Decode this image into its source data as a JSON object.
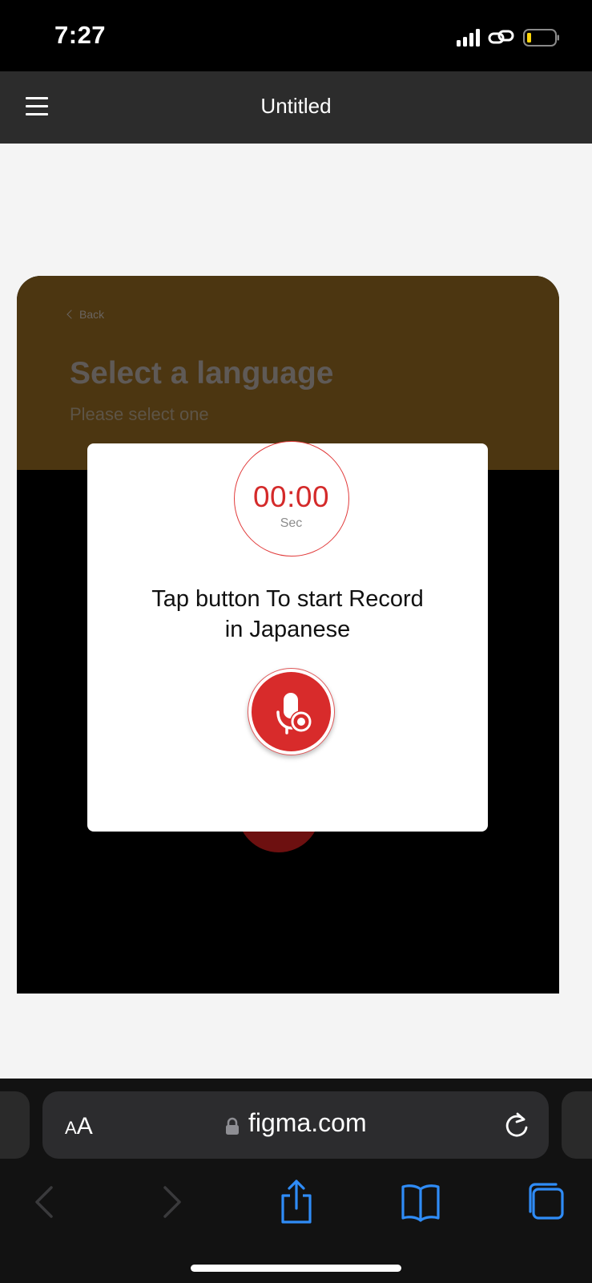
{
  "status_bar": {
    "time": "7:27",
    "icons": [
      "signal-icon",
      "link-icon",
      "battery-icon"
    ]
  },
  "figma_bar": {
    "title": "Untitled",
    "menu_icon": "hamburger-menu-icon"
  },
  "frame": {
    "back_label": "Back",
    "title": "Select a language",
    "subtitle": "Please select one",
    "header_color": "#4c3611"
  },
  "modal": {
    "timer_value": "00:00",
    "timer_unit": "Sec",
    "prompt_line1": "Tap button To start Record",
    "prompt_line2": "in Japanese",
    "record_icon": "microphone-record-icon",
    "accent_color": "#d82b2b"
  },
  "browser": {
    "text_size_small": "A",
    "text_size_big": "A",
    "url": "figma.com",
    "icons": [
      "lock-icon",
      "reload-icon",
      "back-arrow-icon",
      "forward-arrow-icon",
      "share-icon",
      "bookmarks-icon",
      "tabs-icon"
    ]
  }
}
